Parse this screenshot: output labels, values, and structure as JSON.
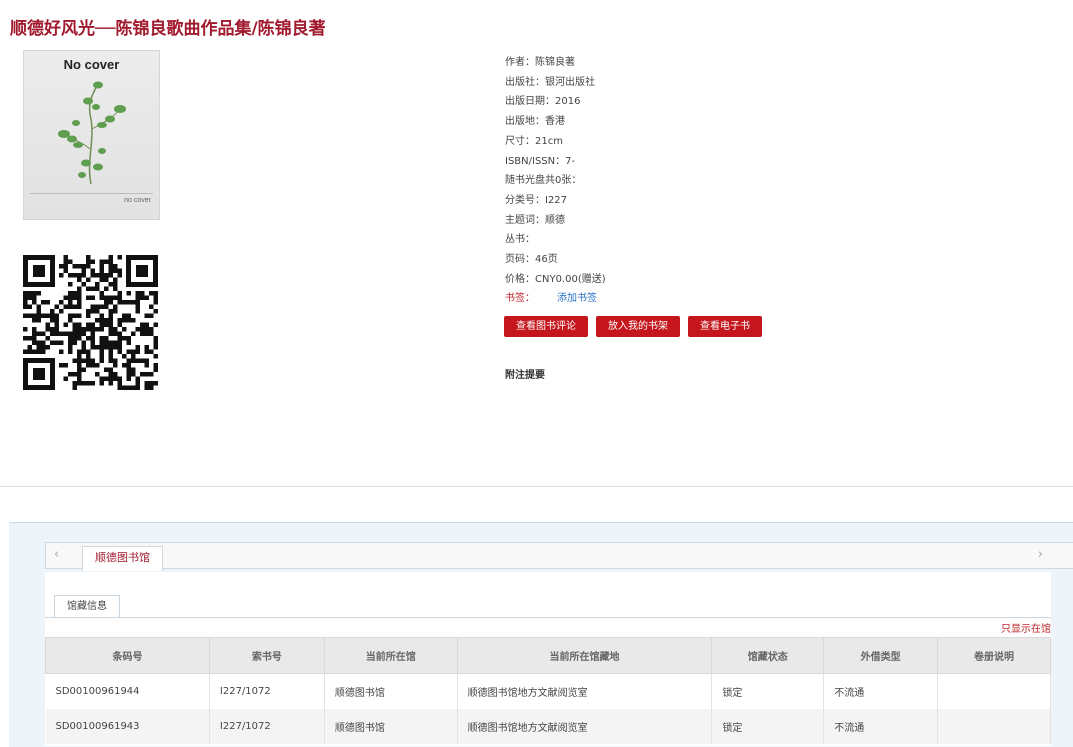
{
  "book": {
    "title": "顺德好风光──陈锦良歌曲作品集/陈锦良著",
    "cover_text": "No cover",
    "cover_small_text": "no cover"
  },
  "info": {
    "author": "作者：陈锦良著",
    "publisher": "出版社：银河出版社",
    "pub_date": "出版日期：2016",
    "pub_place": "出版地：香港",
    "size": "尺寸：21cm",
    "isbn": "ISBN/ISSN：7-",
    "cd": "随书光盘共0张：",
    "class_no": "分类号：I227",
    "subject": "主题词：顺德",
    "series": "丛书：",
    "pages": "页码：46页",
    "price": "价格：CNY0.00(赠送)",
    "tag_label": "书签：",
    "add_tag": "添加书签"
  },
  "buttons": {
    "review": "查看图书评论",
    "shelf": "放入我的书架",
    "ebook": "查看电子书"
  },
  "remark_label": "附注提要",
  "library_tab": "顺德图书馆",
  "holdings": {
    "tab": "馆藏信息",
    "only_show": "只显示在馆",
    "columns": [
      "条码号",
      "索书号",
      "当前所在馆",
      "当前所在馆藏地",
      "馆藏状态",
      "外借类型",
      "卷册说明"
    ],
    "rows": [
      [
        "SD00100961944",
        "I227/1072",
        "顺德图书馆",
        "顺德图书馆地方文献阅览室",
        "锁定",
        "不流通",
        ""
      ],
      [
        "SD00100961943",
        "I227/1072",
        "顺德图书馆",
        "顺德图书馆地方文献阅览室",
        "锁定",
        "不流通",
        ""
      ]
    ]
  },
  "colors": {
    "title": "#a11a2e",
    "button": "#c4161c",
    "link": "#2a72c9"
  }
}
